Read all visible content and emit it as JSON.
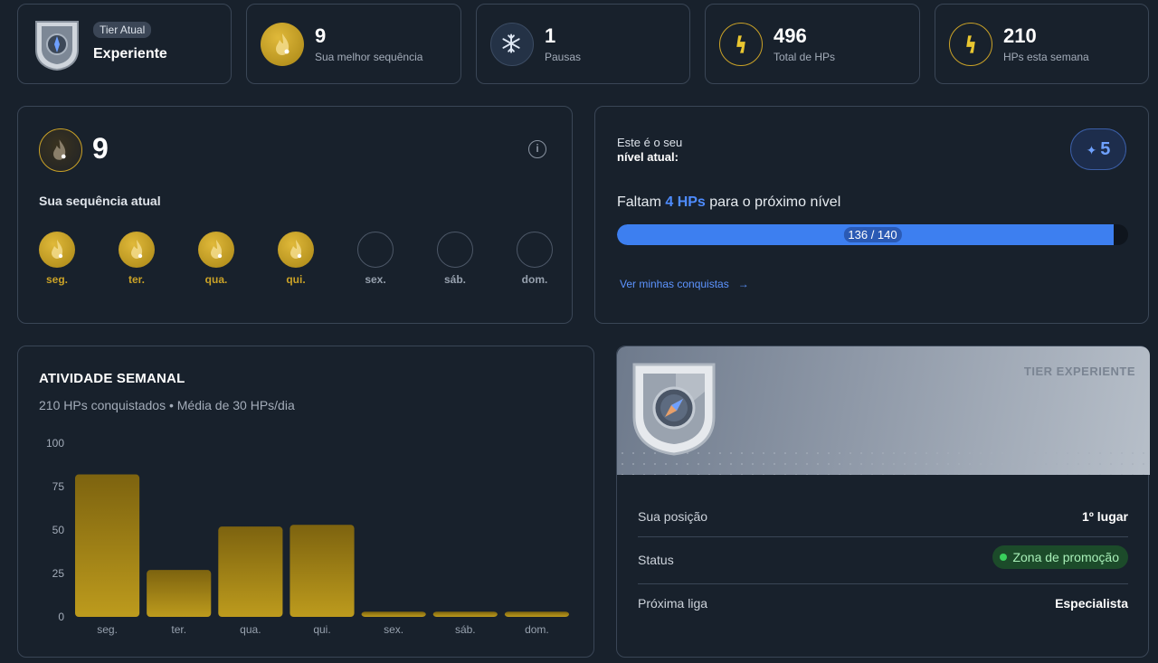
{
  "stats": {
    "tier": {
      "badge": "Tier Atual",
      "name": "Experiente"
    },
    "best_streak": {
      "value": "9",
      "label": "Sua melhor sequência"
    },
    "pauses": {
      "value": "1",
      "label": "Pausas"
    },
    "total_hps": {
      "value": "496",
      "label": "Total de HPs"
    },
    "week_hps": {
      "value": "210",
      "label": "HPs esta semana"
    }
  },
  "streak": {
    "value": "9",
    "title": "Sua sequência atual",
    "info_icon": "i",
    "days": [
      {
        "label": "seg.",
        "done": true
      },
      {
        "label": "ter.",
        "done": true
      },
      {
        "label": "qua.",
        "done": true
      },
      {
        "label": "qui.",
        "done": true
      },
      {
        "label": "sex.",
        "done": false
      },
      {
        "label": "sáb.",
        "done": false
      },
      {
        "label": "dom.",
        "done": false
      }
    ]
  },
  "level": {
    "intro_line1": "Este é o seu",
    "intro_line2": "nível atual:",
    "value": "5",
    "remaining_prefix": "Faltam",
    "remaining_value": "4 HPs",
    "remaining_suffix": "para o próximo nível",
    "progress_text": "136 / 140",
    "progress_fraction": 0.971,
    "link_label": "Ver minhas conquistas",
    "link_arrow": "→"
  },
  "weekly": {
    "title": "ATIVIDADE SEMANAL",
    "subtitle": "210 HPs conquistados • Média de 30 HPs/dia"
  },
  "chart_data": {
    "type": "bar",
    "categories": [
      "seg.",
      "ter.",
      "qua.",
      "qui.",
      "sex.",
      "sáb.",
      "dom."
    ],
    "values": [
      82,
      27,
      52,
      53,
      3,
      3,
      3
    ],
    "ylim": [
      0,
      100
    ],
    "yticks": [
      0,
      25,
      50,
      75,
      100
    ],
    "grid": false,
    "bar_color_top": "#7d630f",
    "bar_color_bottom": "#bd9b1d"
  },
  "tier_card": {
    "hero_label": "TIER EXPERIENTE",
    "rows": {
      "position": {
        "label": "Sua posição",
        "value": "1º lugar"
      },
      "status": {
        "label": "Status",
        "value": "Zona de promoção"
      },
      "next": {
        "label": "Próxima liga",
        "value": "Especialista"
      }
    }
  },
  "colors": {
    "background": "#18212c",
    "accent_blue": "#4e8cff",
    "gold": "#caa227",
    "status_green": "#39d05c"
  }
}
